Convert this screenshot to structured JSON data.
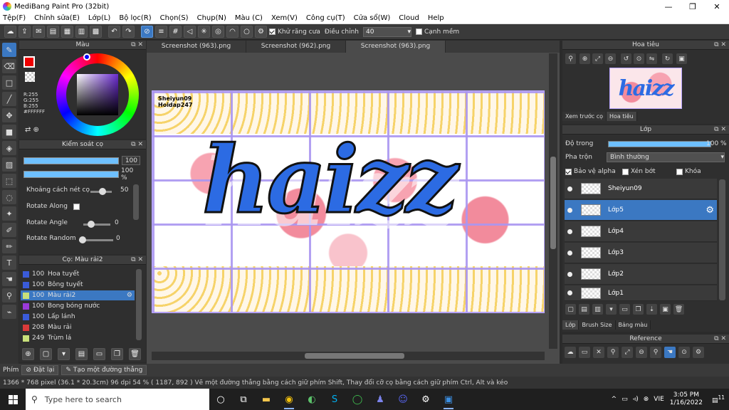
{
  "window": {
    "title": "MediBang Paint Pro (32bit)",
    "minimize": "—",
    "maximize": "❐",
    "close": "✕"
  },
  "menu": [
    "Tệp(F)",
    "Chỉnh sửa(E)",
    "Lớp(L)",
    "Bộ lọc(R)",
    "Chọn(S)",
    "Chụp(N)",
    "Màu (C)",
    "Xem(V)",
    "Công cụ(T)",
    "Cửa sổ(W)",
    "Cloud",
    "Help"
  ],
  "toolbar": {
    "antialias_label": "Khử răng cưa",
    "antialias_checked": true,
    "strength_label": "Điều chỉnh",
    "strength_value": "40",
    "snap_label": "Cạnh mềm",
    "snap_checked": false
  },
  "color_panel": {
    "title": "Màu",
    "r": "R:255",
    "g": "G:255",
    "b": "B:255",
    "hex": "#FFFFFF"
  },
  "brush_control": {
    "title": "Kiểm soát cọ",
    "size_value": "100",
    "opacity_value": "100 %",
    "spacing_label": "Khoảng cách nét cọ",
    "spacing_value": "50",
    "rotate_along_label": "Rotate Along",
    "rotate_angle_label": "Rotate Angle",
    "rotate_angle_value": "0",
    "rotate_random_label": "Rotate Random",
    "rotate_random_value": "0"
  },
  "brush_list": {
    "title": "Cọ: Màu rải2",
    "items": [
      {
        "num": "100",
        "name": "Hoa tuyết",
        "color": "#3a5bd9"
      },
      {
        "num": "100",
        "name": "Bông tuyết",
        "color": "#3a5bd9"
      },
      {
        "num": "100",
        "name": "Màu rải2",
        "color": "#c8e07a",
        "selected": true
      },
      {
        "num": "100",
        "name": "Bong bóng nước",
        "color": "#9a3ad9"
      },
      {
        "num": "100",
        "name": "Lấp lánh",
        "color": "#3a5bd9"
      },
      {
        "num": "208",
        "name": "Màu rải",
        "color": "#d93a3a"
      },
      {
        "num": "249",
        "name": "Trùm lá",
        "color": "#c8e07a"
      }
    ]
  },
  "tabs": [
    {
      "label": "Screenshot (963).png"
    },
    {
      "label": "Screenshot (962).png"
    },
    {
      "label": "Screenshot (963).png",
      "active": true
    }
  ],
  "artwork": {
    "signature_1": "Sheiyun09",
    "signature_2": "Hoidap247",
    "word": "haizz"
  },
  "navigator": {
    "title": "Hoa tiêu",
    "tab_preview": "Xem trước cọ",
    "tab_nav": "Hoa tiêu",
    "thumb_word": "haizz"
  },
  "layer_panel": {
    "title": "Lớp",
    "opacity_label": "Độ trong",
    "opacity_value": "100 %",
    "opacity": 1.0,
    "blend_label": "Pha trộn",
    "blend_value": "Bình thường",
    "protect_alpha": "Bảo vệ alpha",
    "clipping": "Xén bớt",
    "lock": "Khóa",
    "layers": [
      {
        "name": "Sheiyun09"
      },
      {
        "name": "Lớp5",
        "selected": true
      },
      {
        "name": "Lớp4"
      },
      {
        "name": "Lớp3"
      },
      {
        "name": "Lớp2"
      },
      {
        "name": "Lớp1"
      }
    ],
    "bottom_tabs": [
      "Lớp",
      "Brush Size",
      "Bảng màu"
    ]
  },
  "reference": {
    "title": "Reference"
  },
  "statusbar": {
    "tools_label": "Phím",
    "reset_btn": "Đặt lại",
    "newline_btn": "Tạo một đường thẳng",
    "info": "1366 * 768 pixel   (36.1 * 20.3cm)   96 dpi   54 %   ( 1187, 892 )   Vẽ một đường thẳng bằng cách giữ phím Shift, Thay đổi cỡ cọ bằng cách giữ phím Ctrl, Alt và kéo"
  },
  "taskbar": {
    "search_placeholder": "Type here to search",
    "lang": "VIE",
    "time": "3:05 PM",
    "date": "1/16/2022",
    "notif": "11"
  }
}
